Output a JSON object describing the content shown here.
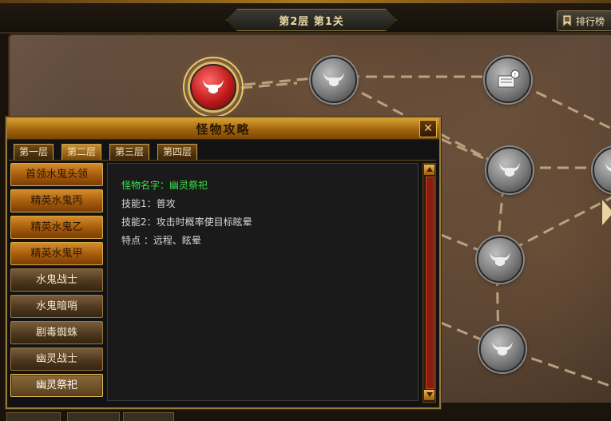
{
  "header": {
    "level_title": "第2层 第1关",
    "ranking_label": "排行榜"
  },
  "map": {
    "nodes": [
      {
        "name": "monster-node-1",
        "state": "active",
        "icon": "bull-head-icon"
      },
      {
        "name": "monster-node-2",
        "state": "locked",
        "icon": "bull-head-icon"
      },
      {
        "name": "scroll-node",
        "state": "locked",
        "icon": "scroll-icon"
      },
      {
        "name": "monster-node-3",
        "state": "locked",
        "icon": "bull-head-icon"
      },
      {
        "name": "monster-node-4",
        "state": "locked",
        "icon": "bull-head-icon"
      },
      {
        "name": "monster-node-5",
        "state": "locked",
        "icon": "bull-head-icon"
      },
      {
        "name": "monster-node-6",
        "state": "locked",
        "icon": "bull-head-icon"
      }
    ]
  },
  "panel": {
    "title": "怪物攻略",
    "close_label": "✕",
    "tabs": [
      "第一层",
      "第二层",
      "第三层",
      "第四层"
    ],
    "selected_tab": 1,
    "monsters": [
      "首领水鬼头领",
      "精英水鬼丙",
      "精英水鬼乙",
      "精英水鬼甲",
      "水鬼战士",
      "水鬼暗哨",
      "剧毒蜘蛛",
      "幽灵战士",
      "幽灵祭祀"
    ],
    "selected_monster": 8,
    "detail": {
      "name_line": "怪物名字：幽灵祭祀",
      "skill1_line": "技能1：普攻",
      "skill2_line": "技能2：攻击时概率使目标眩晕",
      "trait_line": "特点 ：远程、眩晕"
    }
  },
  "colors": {
    "accent_gold": "#d9a031",
    "active_node_red": "#c01a1a",
    "monster_name_green": "#39e04a"
  }
}
